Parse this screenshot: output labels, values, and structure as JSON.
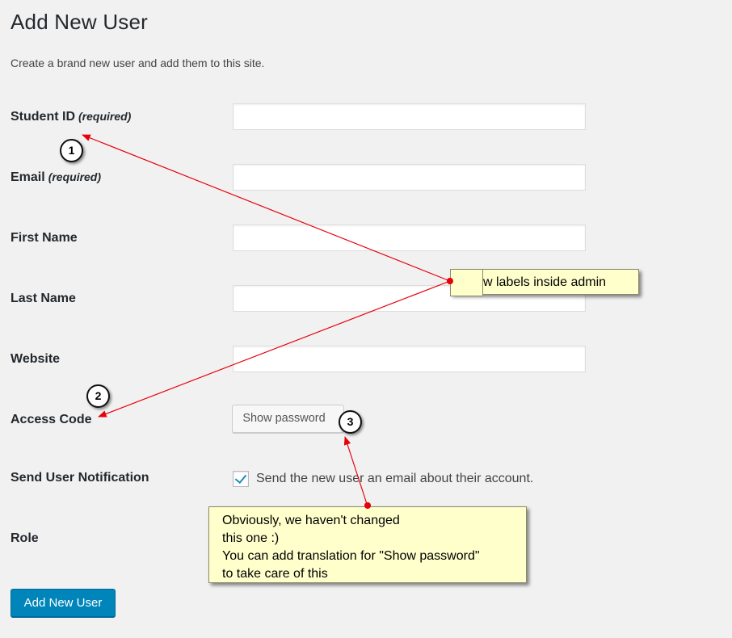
{
  "page": {
    "title": "Add New User",
    "description": "Create a brand new user and add them to this site."
  },
  "form": {
    "required_marker": "(required)",
    "fields": [
      {
        "label": "Student ID",
        "required": true,
        "value": ""
      },
      {
        "label": "Email",
        "required": true,
        "value": ""
      },
      {
        "label": "First Name",
        "required": false,
        "value": ""
      },
      {
        "label": "Last Name",
        "required": false,
        "value": ""
      },
      {
        "label": "Website",
        "required": false,
        "value": ""
      }
    ],
    "access_code": {
      "label": "Access Code",
      "button_label": "Show password"
    },
    "notification": {
      "label": "Send User Notification",
      "checkbox_label": "Send the new user an email about their account.",
      "checked": true
    },
    "role": {
      "label": "Role"
    },
    "submit_label": "Add New User"
  },
  "annotations": {
    "callout_1_text": "w labels inside admin",
    "callout_2_lines": [
      "Obviously, we haven't changed",
      "this one :)",
      "You can add translation for \"Show password\"",
      "to take care of this"
    ],
    "badges": [
      "1",
      "2",
      "3"
    ],
    "arrow_color": "#e8000b"
  },
  "colors": {
    "background": "#f1f1f1",
    "primary_button": "#0085ba",
    "checkbox_tick": "#1e8cbe",
    "callout_fill": "#ffffcc"
  }
}
